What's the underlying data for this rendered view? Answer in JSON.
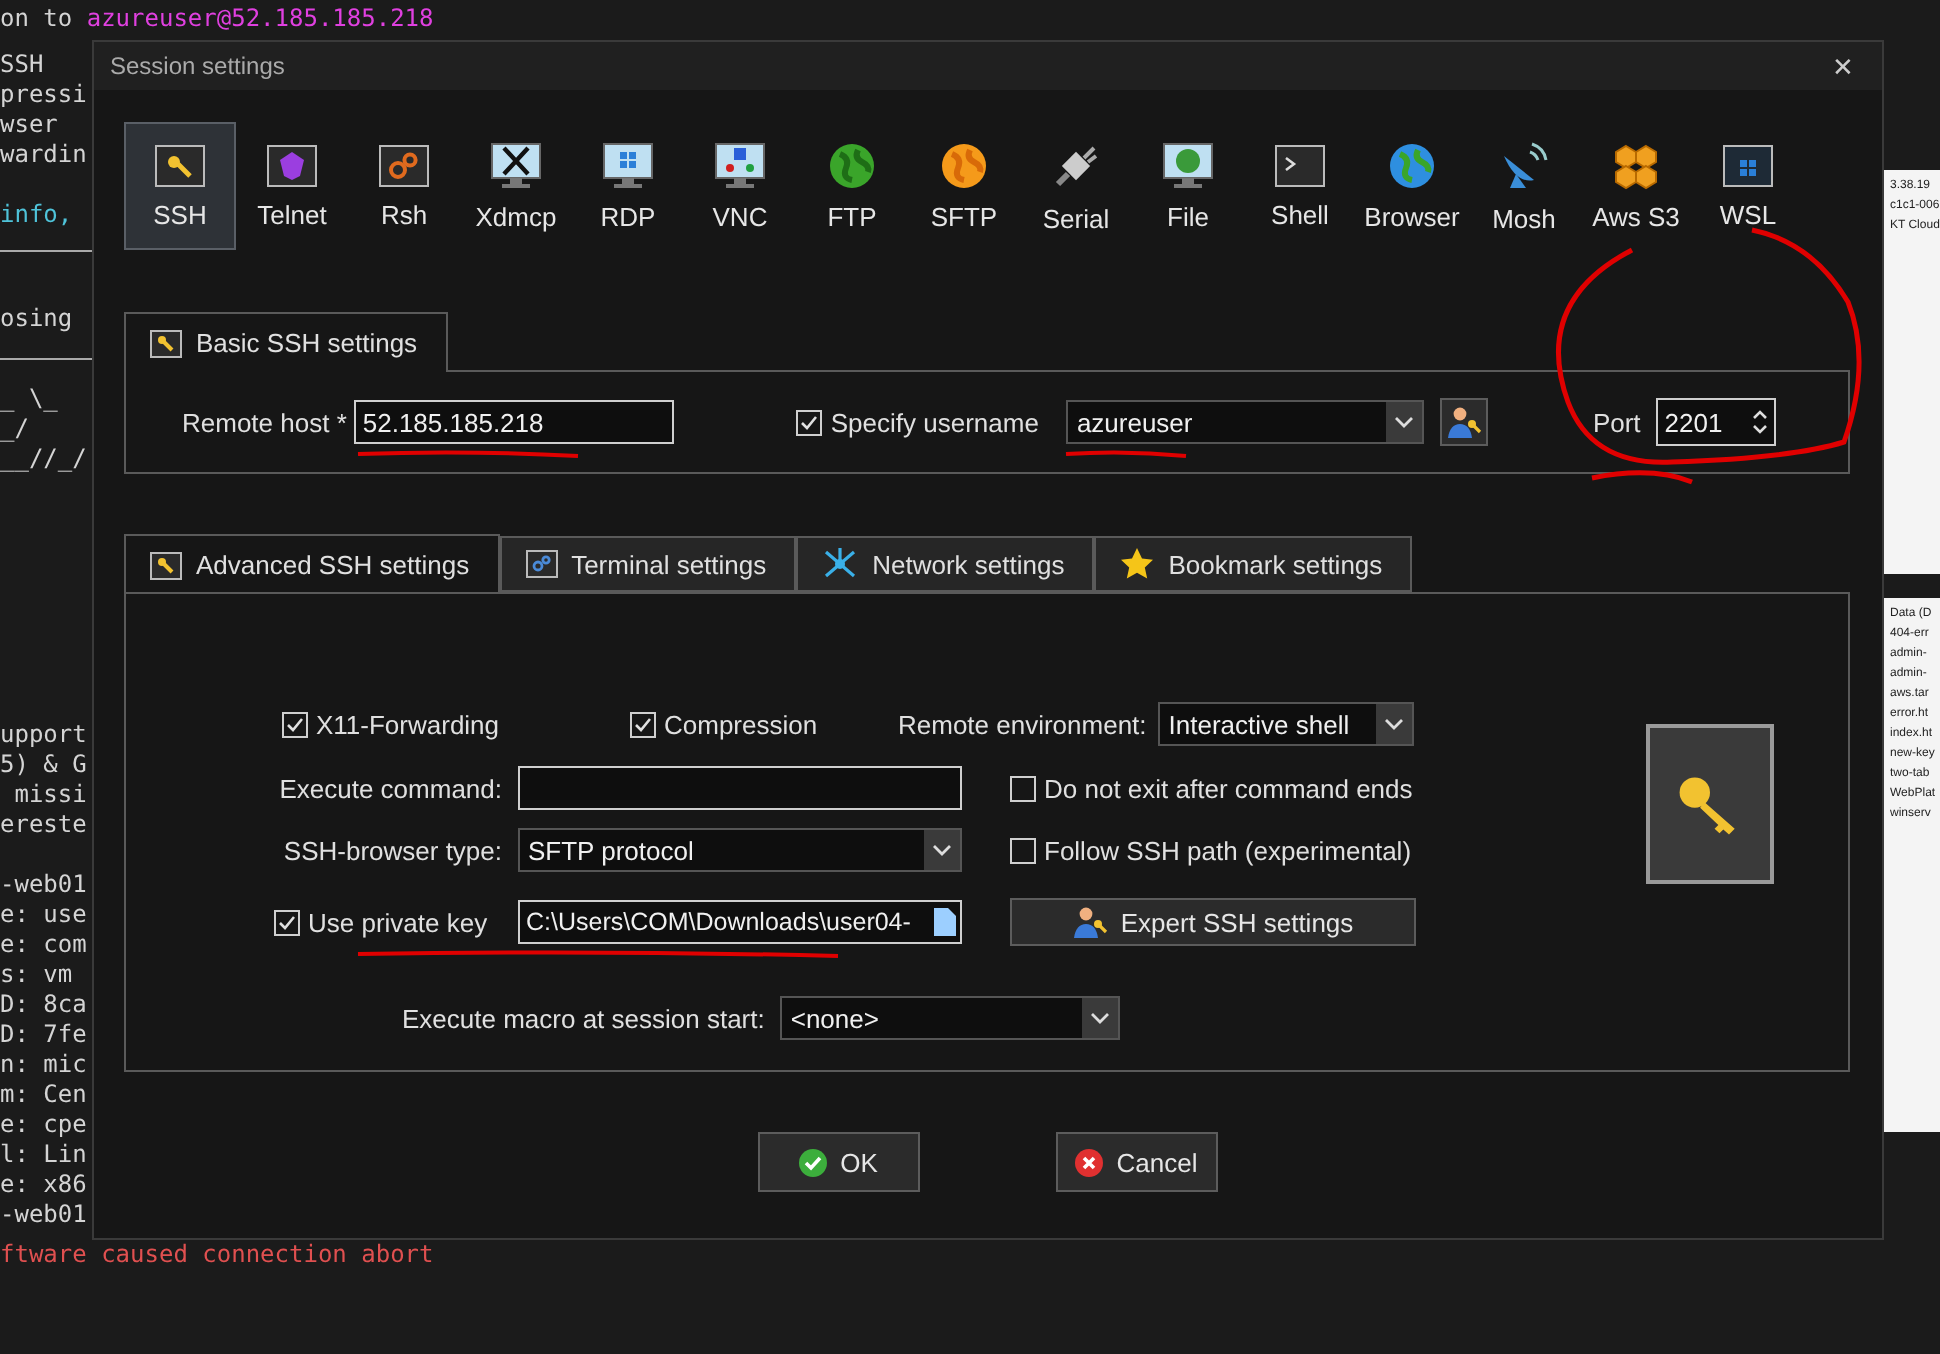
{
  "terminal": {
    "first_line": [
      {
        "text": "on to ",
        "color": "#d4d4d4"
      },
      {
        "text": "azureuser@52.185.185.218",
        "color": "#e040e0"
      }
    ],
    "blocks": [
      {
        "lines": [
          "SSH",
          "pressi",
          "wser",
          "wardin"
        ],
        "color": "#d4d4d4"
      },
      {
        "lines": [
          "info,"
        ],
        "color": "#4fc3d9"
      },
      {
        "lines": [
          "osing"
        ],
        "color": "#d4d4d4"
      },
      {
        "lines": [
          "_ \\_",
          "_/",
          "__//_/"
        ],
        "color": "#d4d4d4"
      },
      {
        "lines": [
          "upport",
          "5) & G",
          " missi",
          "ereste"
        ],
        "color": "#d4d4d4"
      },
      {
        "lines": [
          "-web01",
          "e: use",
          "e: com",
          "s: vm",
          "D: 8ca",
          "D: 7fe",
          "n: mic",
          "m: Cen",
          "e: cpe",
          "l: Lin",
          "e: x86",
          "-web01"
        ],
        "color": "#d4d4d4"
      }
    ],
    "last_line": {
      "text": "ftware caused connection abort",
      "color": "#e05050"
    }
  },
  "side_windows": [
    {
      "lines": [
        "3.38.19",
        "c1c1-006",
        "KT Cloud"
      ]
    },
    {
      "lines": [
        "Data (D",
        "404-err",
        "admin-",
        "admin-",
        "aws.tar",
        "error.ht",
        "index.ht",
        "new-key",
        "two-tab",
        "WebPlat",
        "winserv"
      ]
    }
  ],
  "dialog": {
    "title": "Session settings",
    "close": "✕",
    "sessions": [
      {
        "label": "SSH",
        "selected": true
      },
      {
        "label": "Telnet",
        "selected": false
      },
      {
        "label": "Rsh",
        "selected": false
      },
      {
        "label": "Xdmcp",
        "selected": false
      },
      {
        "label": "RDP",
        "selected": false
      },
      {
        "label": "VNC",
        "selected": false
      },
      {
        "label": "FTP",
        "selected": false
      },
      {
        "label": "SFTP",
        "selected": false
      },
      {
        "label": "Serial",
        "selected": false
      },
      {
        "label": "File",
        "selected": false
      },
      {
        "label": "Shell",
        "selected": false
      },
      {
        "label": "Browser",
        "selected": false
      },
      {
        "label": "Mosh",
        "selected": false
      },
      {
        "label": "Aws S3",
        "selected": false
      },
      {
        "label": "WSL",
        "selected": false
      }
    ],
    "basic": {
      "tab": "Basic SSH settings",
      "remote_host_label": "Remote host *",
      "remote_host": {
        "value": "52.185.185.218",
        "underlined": true
      },
      "specify_username": {
        "label": "Specify username",
        "checked": true
      },
      "username": {
        "value": "azureuser",
        "underlined": true
      },
      "port_label": "Port",
      "port": {
        "value": "2201",
        "circled": true
      }
    },
    "tabs": [
      {
        "label": "Advanced SSH settings",
        "selected": true
      },
      {
        "label": "Terminal settings",
        "selected": false
      },
      {
        "label": "Network settings",
        "selected": false
      },
      {
        "label": "Bookmark settings",
        "selected": false
      }
    ],
    "advanced": {
      "x11": {
        "label": "X11-Forwarding",
        "checked": true
      },
      "compression": {
        "label": "Compression",
        "checked": true
      },
      "remote_env_label": "Remote environment:",
      "remote_env": "Interactive shell",
      "exec_label": "Execute command:",
      "no_exit": {
        "label": "Do not exit after command ends",
        "checked": false
      },
      "browser_label": "SSH-browser type:",
      "browser": "SFTP protocol",
      "follow": {
        "label": "Follow SSH path (experimental)",
        "checked": false
      },
      "private_key": {
        "label": "Use private key",
        "checked": true
      },
      "key_path": {
        "value": "C:\\Users\\COM\\Downloads\\user04-",
        "underlined": true
      },
      "expert": "Expert SSH settings",
      "macro_label": "Execute macro at session start:",
      "macro": "<none>"
    },
    "buttons": [
      {
        "label": "OK",
        "kind": "ok"
      },
      {
        "label": "Cancel",
        "kind": "cancel"
      }
    ]
  }
}
